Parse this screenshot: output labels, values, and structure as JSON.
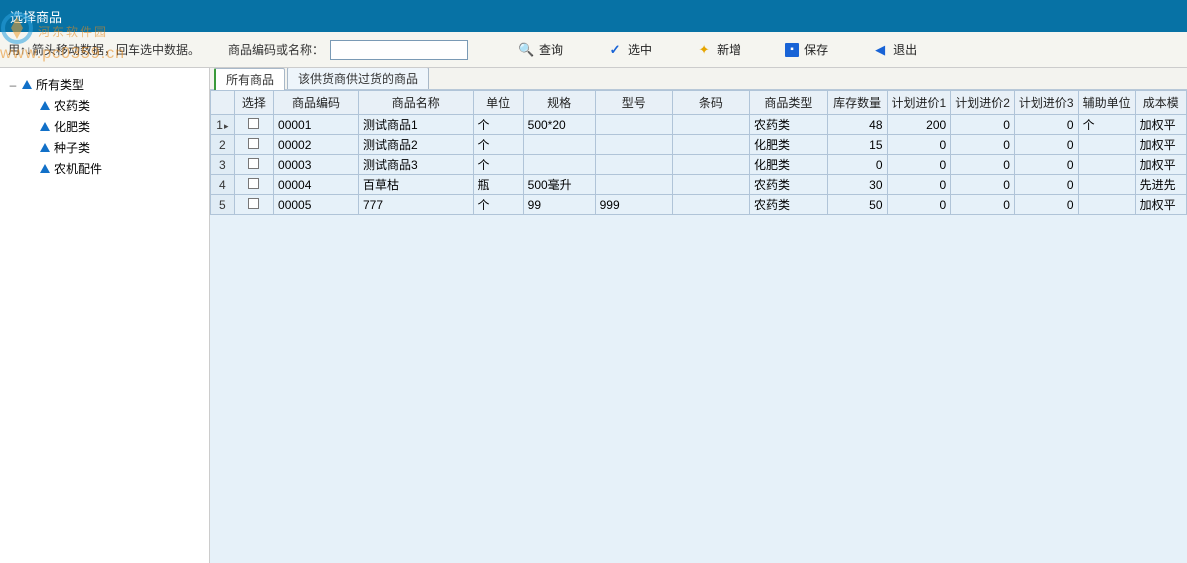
{
  "window": {
    "title": "选择商品"
  },
  "toolbar": {
    "hint": "用↑↓箭头移动数据，回车选中数据。",
    "search_label": "商品编码或名称：",
    "search_value": "",
    "query": "查询",
    "select": "选中",
    "add": "新增",
    "save": "保存",
    "exit": "退出"
  },
  "watermark": {
    "top": "河东软件园",
    "bottom": "www.pc0359.cn"
  },
  "tree": {
    "root": "所有类型",
    "children": [
      "农药类",
      "化肥类",
      "种子类",
      "农机配件"
    ]
  },
  "tabs": {
    "all": "所有商品",
    "supplier": "该供货商供过货的商品"
  },
  "grid": {
    "headers": {
      "row": "",
      "select": "选择",
      "code": "商品编码",
      "name": "商品名称",
      "unit": "单位",
      "spec": "规格",
      "model": "型号",
      "barcode": "条码",
      "type": "商品类型",
      "stock": "库存数量",
      "p1": "计划进价1",
      "p2": "计划进价2",
      "p3": "计划进价3",
      "aunit": "辅助单位",
      "cost": "成本模"
    },
    "rows": [
      {
        "n": "1",
        "code": "00001",
        "name": "测试商品1",
        "unit": "个",
        "spec": "500*20",
        "model": "",
        "barcode": "",
        "type": "农药类",
        "stock": "48",
        "p1": "200",
        "p2": "0",
        "p3": "0",
        "aunit": "个",
        "cost": "加权平"
      },
      {
        "n": "2",
        "code": "00002",
        "name": "测试商品2",
        "unit": "个",
        "spec": "",
        "model": "",
        "barcode": "",
        "type": "化肥类",
        "stock": "15",
        "p1": "0",
        "p2": "0",
        "p3": "0",
        "aunit": "",
        "cost": "加权平"
      },
      {
        "n": "3",
        "code": "00003",
        "name": "测试商品3",
        "unit": "个",
        "spec": "",
        "model": "",
        "barcode": "",
        "type": "化肥类",
        "stock": "0",
        "p1": "0",
        "p2": "0",
        "p3": "0",
        "aunit": "",
        "cost": "加权平"
      },
      {
        "n": "4",
        "code": "00004",
        "name": "百草枯",
        "unit": "瓶",
        "spec": "500毫升",
        "model": "",
        "barcode": "",
        "type": "农药类",
        "stock": "30",
        "p1": "0",
        "p2": "0",
        "p3": "0",
        "aunit": "",
        "cost": "先进先"
      },
      {
        "n": "5",
        "code": "00005",
        "name": "777",
        "unit": "个",
        "spec": "99",
        "model": "999",
        "barcode": "",
        "type": "农药类",
        "stock": "50",
        "p1": "0",
        "p2": "0",
        "p3": "0",
        "aunit": "",
        "cost": "加权平"
      }
    ]
  }
}
